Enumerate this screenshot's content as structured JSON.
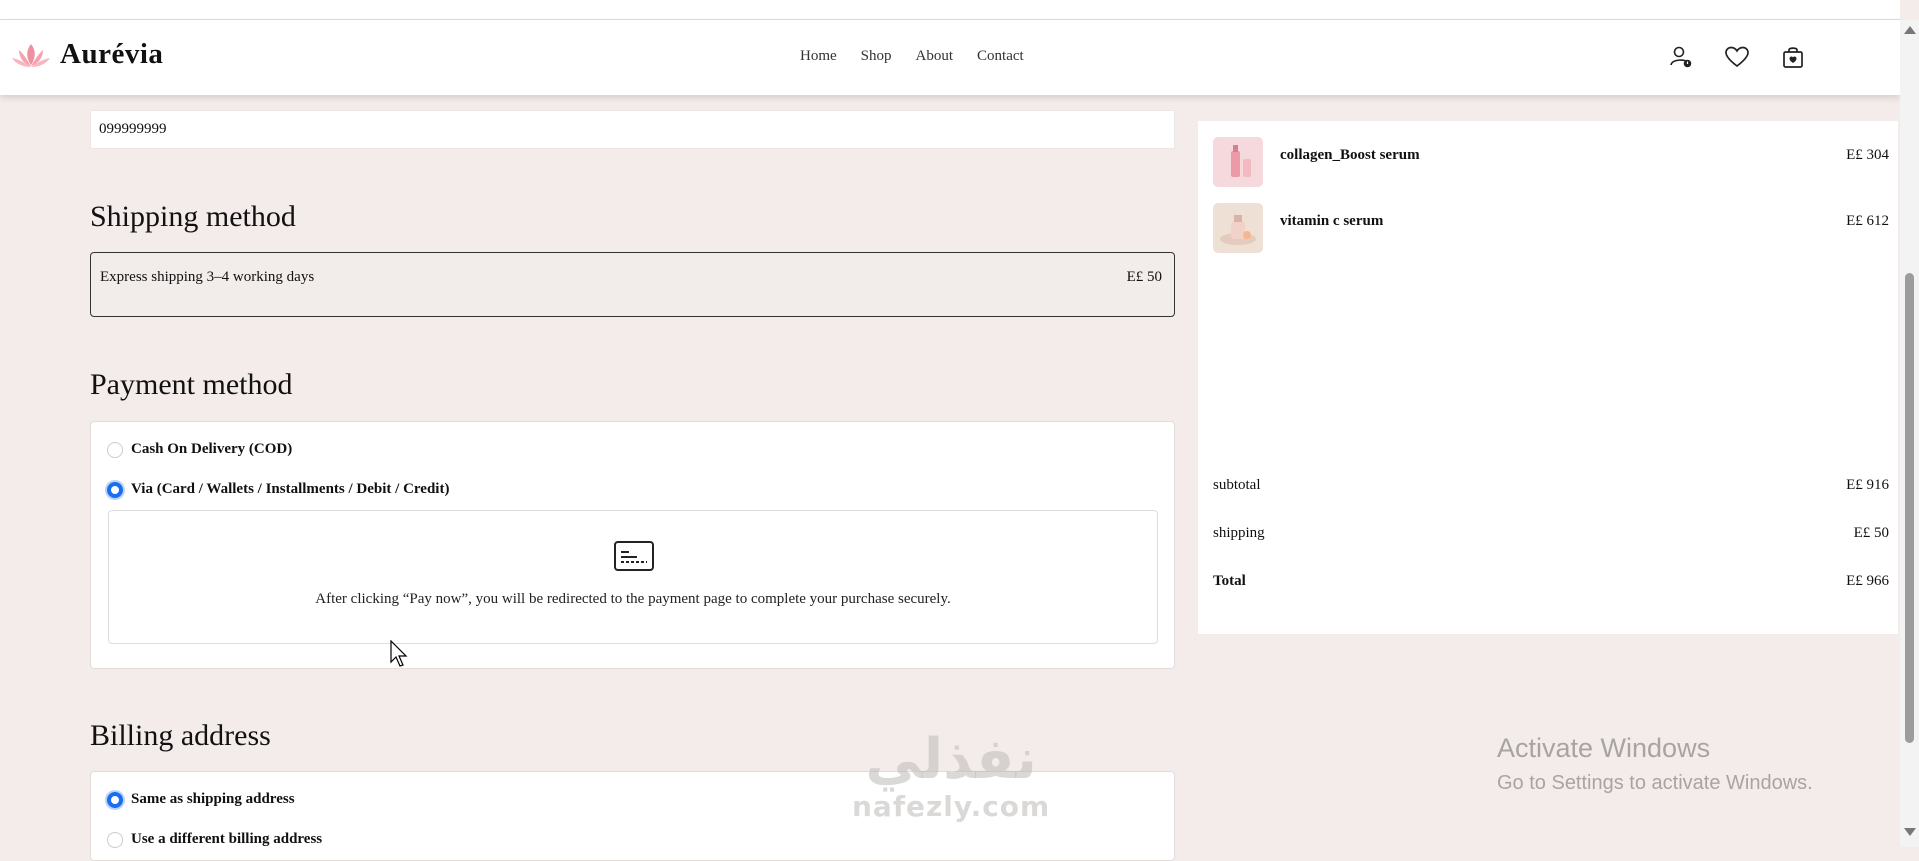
{
  "brand": {
    "name": "Aurévia",
    "logo_icon": "lotus-icon"
  },
  "nav": {
    "items": [
      "Home",
      "Shop",
      "About",
      "Contact"
    ]
  },
  "header_icons": [
    "user-icon",
    "heart-icon",
    "cart-icon"
  ],
  "contact": {
    "phone_value": "099999999"
  },
  "shipping": {
    "heading": "Shipping method",
    "option_label": "Express shipping 3–4 working days",
    "option_price": "E£ 50"
  },
  "payment": {
    "heading": "Payment method",
    "options": [
      {
        "label": "Cash On Delivery (COD)",
        "selected": false
      },
      {
        "label": "Via (Card / Wallets / Installments / Debit / Credit)",
        "selected": true
      }
    ],
    "card_icon": "credit-card-icon",
    "message": "After clicking “Pay now”, you will be redirected to the payment page to complete your purchase securely."
  },
  "billing": {
    "heading": "Billing address",
    "options": [
      {
        "label": "Same as shipping address",
        "selected": true
      },
      {
        "label": "Use a different billing address",
        "selected": false
      }
    ]
  },
  "order": {
    "items": [
      {
        "name": "collagen_Boost serum",
        "price": "E£ 304"
      },
      {
        "name": "vitamin c serum",
        "price": "E£ 612"
      }
    ],
    "subtotal_label": "subtotal",
    "subtotal_value": "E£ 916",
    "shipping_label": "shipping",
    "shipping_value": "E£ 50",
    "total_label": "Total",
    "total_value": "E£ 966"
  },
  "os_watermark": {
    "title": "Activate Windows",
    "subtitle": "Go to Settings to activate Windows."
  },
  "site_watermark": {
    "arabic": "نفذلي",
    "latin": "nafezly.com"
  },
  "colors": {
    "accent": "#1a6ef0",
    "background": "#f4ecea",
    "logo": "#f08fa0"
  }
}
